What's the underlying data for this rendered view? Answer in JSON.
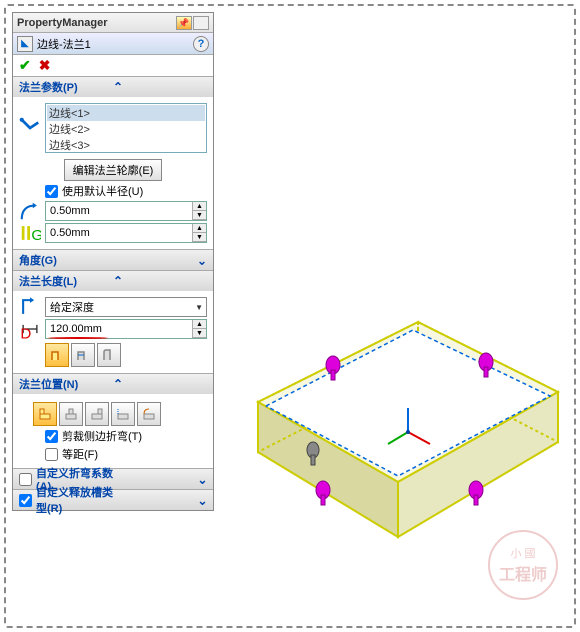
{
  "header": {
    "title": "PropertyManager"
  },
  "feature": {
    "name": "边线-法兰1"
  },
  "sections": {
    "params": {
      "title": "法兰参数(P)",
      "edges": [
        "边线<1>",
        "边线<2>",
        "边线<3>"
      ],
      "edit_profile_btn": "编辑法兰轮廓(E)",
      "use_default_radius": "使用默认半径(U)",
      "radius1": "0.50mm",
      "radius2": "0.50mm"
    },
    "angle": {
      "title": "角度(G)"
    },
    "length": {
      "title": "法兰长度(L)",
      "end_condition": "给定深度",
      "value": "120.00mm"
    },
    "position": {
      "title": "法兰位置(N)",
      "trim_side_bends": "剪裁侧边折弯(T)",
      "equal_offset": "等距(F)"
    },
    "custom_bend": {
      "title": "自定义折弯系数(A)"
    },
    "custom_relief": {
      "title": "自定义释放槽类型(R)"
    }
  },
  "watermark": {
    "l1": "小 國",
    "l2": "工程师"
  }
}
